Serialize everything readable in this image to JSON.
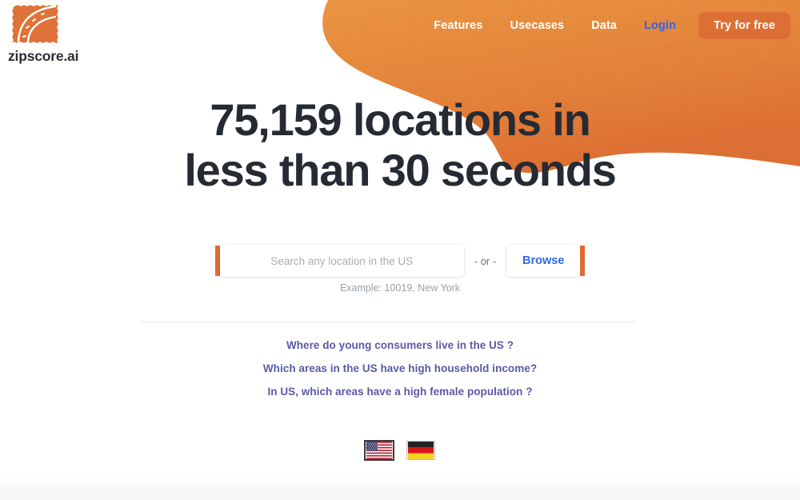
{
  "brand": {
    "name": "zipscore.ai",
    "logo_icon": "stamp-road-logo-icon",
    "accent_orange": "#e06a33",
    "blob_orange_light": "#e9903f",
    "blob_orange_dark": "#dd7033"
  },
  "nav": {
    "items": [
      {
        "label": "Features",
        "name": "nav-link-features",
        "style": "white"
      },
      {
        "label": "Usecases",
        "name": "nav-link-usecases",
        "style": "white"
      },
      {
        "label": "Data",
        "name": "nav-link-data",
        "style": "white"
      },
      {
        "label": "Login",
        "name": "nav-link-login",
        "style": "blue"
      }
    ],
    "cta": {
      "label": "Try for free",
      "color": "#dd6f35"
    }
  },
  "hero": {
    "line1": "75,159 locations in",
    "line2": "less than 30 seconds",
    "location_count": "75,159",
    "seconds": "30",
    "text_color": "#262b33"
  },
  "search": {
    "placeholder": "Search any location in the US",
    "value": "",
    "separator": "- or -",
    "browse_label": "Browse",
    "example_text": "Example: 10019, New York",
    "accent_color": "#e06a33",
    "browse_color": "#2f6ae8"
  },
  "questions": {
    "link_color": "#5a5aa8",
    "items": [
      "Where do young consumers live in the US ?",
      "Which areas in the US have high household income?",
      "In US, which areas have a high female population ?"
    ]
  },
  "languages": [
    {
      "name": "flag-us",
      "label": "United States",
      "selected": true
    },
    {
      "name": "flag-de",
      "label": "Germany",
      "selected": false
    }
  ]
}
